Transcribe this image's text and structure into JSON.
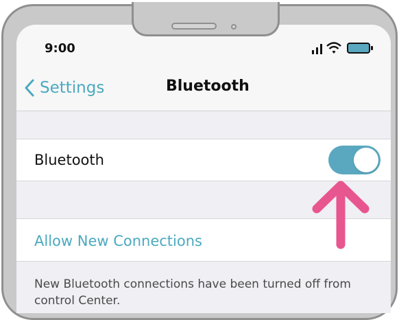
{
  "status_bar": {
    "time": "9:00",
    "icons": [
      "signal-icon",
      "wifi-icon",
      "battery-icon"
    ]
  },
  "nav": {
    "back_label": "Settings",
    "title": "Bluetooth"
  },
  "bluetooth_row": {
    "label": "Bluetooth",
    "toggle_state": "on"
  },
  "connections_row": {
    "label": "Allow New Connections"
  },
  "footer": {
    "note": "New Bluetooth connections have been turned off from control Center."
  },
  "colors": {
    "accent": "#4ba9bf",
    "toggle_on": "#5aa8bf",
    "annotation_arrow": "#e8568f"
  }
}
